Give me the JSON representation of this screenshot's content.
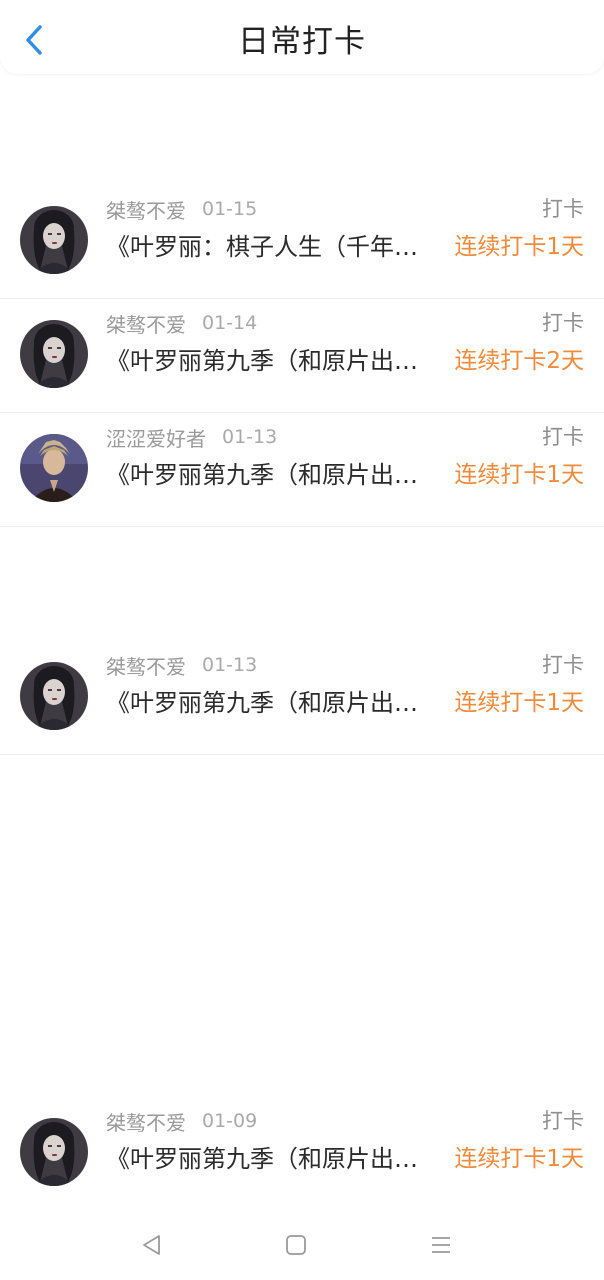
{
  "header": {
    "title": "日常打卡",
    "back_icon": "chevron-left-icon"
  },
  "accent_color": "#f08a3c",
  "back_color": "#2f8ee8",
  "entries": [
    {
      "user": "桀骜不爱",
      "date": "01-15",
      "type": "打卡",
      "book": "《叶罗丽：棋子人生（千年…",
      "streak": "连续打卡1天",
      "avatar": "gothic-girl-avatar"
    },
    {
      "user": "桀骜不爱",
      "date": "01-14",
      "type": "打卡",
      "book": "《叶罗丽第九季（和原片出…",
      "streak": "连续打卡2天",
      "avatar": "gothic-girl-avatar"
    },
    {
      "user": "涩涩爱好者",
      "date": "01-13",
      "type": "打卡",
      "book": "《叶罗丽第九季（和原片出…",
      "streak": "连续打卡1天",
      "avatar": "blond-man-avatar"
    },
    {
      "user": "桀骜不爱",
      "date": "01-13",
      "type": "打卡",
      "book": "《叶罗丽第九季（和原片出…",
      "streak": "连续打卡1天",
      "avatar": "gothic-girl-avatar"
    },
    {
      "user": "桀骜不爱",
      "date": "01-09",
      "type": "打卡",
      "book": "《叶罗丽第九季（和原片出…",
      "streak": "连续打卡1天",
      "avatar": "gothic-girl-avatar"
    }
  ],
  "system_nav": {
    "back": "triangle-back-icon",
    "home": "square-home-icon",
    "menu": "three-lines-menu-icon"
  }
}
